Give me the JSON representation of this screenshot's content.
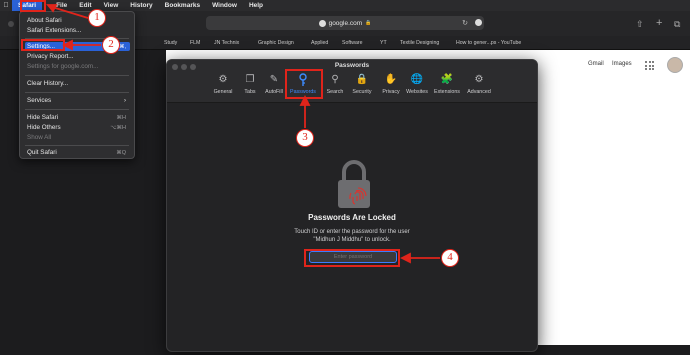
{
  "menubar": {
    "apple": "",
    "items": [
      "Safari",
      "File",
      "Edit",
      "View",
      "History",
      "Bookmarks",
      "Window",
      "Help"
    ]
  },
  "toolbar": {
    "url": "google.com"
  },
  "bookmarks": [
    "Study",
    "FLM",
    "JN Technix",
    "Graphic Design",
    "Applied",
    "Software",
    "YT",
    "Textile Designing",
    "How to gener...ps - YouTube"
  ],
  "google_nav": {
    "gmail": "Gmail",
    "images": "Images"
  },
  "safari_menu": {
    "items": [
      {
        "label": "About Safari",
        "disabled": false
      },
      {
        "label": "Safari Extensions...",
        "disabled": false
      },
      {
        "label": "Settings...",
        "disabled": false,
        "highlight": true,
        "shortcut": "⌘,"
      },
      {
        "label": "Privacy Report...",
        "disabled": false
      },
      {
        "label": "Settings for google.com...",
        "disabled": true
      },
      {
        "label": "Clear History...",
        "disabled": false
      },
      {
        "label": "Services",
        "disabled": false,
        "submenu": true
      },
      {
        "label": "Hide Safari",
        "disabled": false,
        "shortcut": "⌘H"
      },
      {
        "label": "Hide Others",
        "disabled": false,
        "shortcut": "⌥⌘H"
      },
      {
        "label": "Show All",
        "disabled": true
      },
      {
        "label": "Quit Safari",
        "disabled": false,
        "shortcut": "⌘Q"
      }
    ]
  },
  "passwords_window": {
    "title": "Passwords",
    "tabs": [
      {
        "label": "General",
        "icon": "gear-icon"
      },
      {
        "label": "Tabs",
        "icon": "tabs-icon"
      },
      {
        "label": "AutoFill",
        "icon": "autofill-icon"
      },
      {
        "label": "Passwords",
        "icon": "key-icon",
        "active": true
      },
      {
        "label": "Search",
        "icon": "search-icon"
      },
      {
        "label": "Security",
        "icon": "lock-icon"
      },
      {
        "label": "Privacy",
        "icon": "hand-icon"
      },
      {
        "label": "Websites",
        "icon": "globe-icon"
      },
      {
        "label": "Extensions",
        "icon": "puzzle-icon"
      },
      {
        "label": "Advanced",
        "icon": "gears-icon"
      }
    ],
    "locked_title": "Passwords Are Locked",
    "locked_desc_line1": "Touch ID or enter the password for the user",
    "locked_desc_line2": "\"Midhun J Middhu\" to unlock.",
    "password_placeholder": "Enter password"
  },
  "annotations": [
    "1",
    "2",
    "3",
    "4"
  ],
  "colors": {
    "annotation_red": "#e0241b",
    "accent_blue": "#3d8bff",
    "menu_highlight": "#2a62d8"
  }
}
